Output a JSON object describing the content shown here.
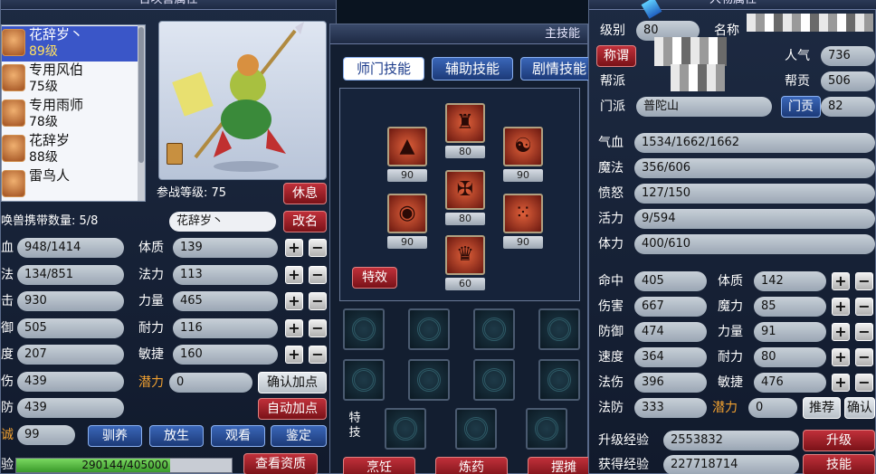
{
  "left": {
    "title": "召唤兽属性",
    "pets": [
      {
        "name": "花辞岁丶",
        "level": "89级",
        "selected": true
      },
      {
        "name": "专用风伯",
        "level": "75级"
      },
      {
        "name": "专用雨师",
        "level": "78级"
      },
      {
        "name": "花辞岁",
        "level": "88级"
      },
      {
        "name": "雷鸟人",
        "level": ""
      }
    ],
    "battle_level_label": "参战等级:",
    "battle_level": "75",
    "rest_btn": "休息",
    "carry_label": "唤兽携带数量:",
    "carry_value": "5/8",
    "pet_name_value": "花辞岁丶",
    "rename_btn": "改名",
    "stats_left": [
      {
        "label": "血",
        "value": "948/1414"
      },
      {
        "label": "法",
        "value": "134/851"
      },
      {
        "label": "击",
        "value": "930"
      },
      {
        "label": "御",
        "value": "505"
      },
      {
        "label": "度",
        "value": "207"
      },
      {
        "label": "伤",
        "value": "439"
      },
      {
        "label": "防",
        "value": "439"
      },
      {
        "label": "诚",
        "value": "99"
      }
    ],
    "stats_right": [
      {
        "label": "体质",
        "value": "139"
      },
      {
        "label": "法力",
        "value": "113"
      },
      {
        "label": "力量",
        "value": "465"
      },
      {
        "label": "耐力",
        "value": "116"
      },
      {
        "label": "敏捷",
        "value": "160"
      }
    ],
    "potential_label": "潜力",
    "potential_value": "0",
    "confirm_points_btn": "确认加点",
    "auto_points_btn": "自动加点",
    "tame_btn": "驯养",
    "release_btn": "放生",
    "watch_btn": "观看",
    "appraise_btn": "鉴定",
    "exp_label": "验",
    "exp_value": "290144/405000",
    "exp_fraction": 0.716,
    "view_quality_btn": "查看资质",
    "plus": "+",
    "minus": "−"
  },
  "middle": {
    "title": "主技能",
    "tabs": [
      "师门技能",
      "辅助技能",
      "剧情技能"
    ],
    "skills": [
      {
        "icon": "stupa-icon",
        "glyph": "▲",
        "level": "90"
      },
      {
        "icon": "helmet-icon",
        "glyph": "♜",
        "level": "80"
      },
      {
        "icon": "head-icon",
        "glyph": "☯",
        "level": "90"
      },
      {
        "icon": "seal-icon",
        "glyph": "◉",
        "level": "90"
      },
      {
        "icon": "rune-icon",
        "glyph": "✠",
        "level": "80"
      },
      {
        "icon": "dice-icon",
        "glyph": "⁙",
        "level": "90"
      },
      {
        "icon": "crown-icon",
        "glyph": "♛",
        "level": "60"
      }
    ],
    "effect_btn": "特效",
    "special_label": "特技",
    "bottom_btns": [
      "烹饪",
      "炼药",
      "摆摊"
    ]
  },
  "right": {
    "title": "人物属性",
    "level_label": "级别",
    "level_value": "80",
    "name_label": "名称",
    "title_btn": "称谓",
    "popularity_label": "人气",
    "popularity_value": "736",
    "guild_label": "帮派",
    "guild_contrib_label": "帮贡",
    "guild_contrib_value": "506",
    "school_label": "门派",
    "school_value": "普陀山",
    "school_contrib_btn": "门贡",
    "school_contrib_value": "82",
    "vitals": [
      {
        "label": "气血",
        "value": "1534/1662/1662"
      },
      {
        "label": "魔法",
        "value": "356/606"
      },
      {
        "label": "愤怒",
        "value": "127/150"
      },
      {
        "label": "活力",
        "value": "9/594"
      },
      {
        "label": "体力",
        "value": "400/610"
      }
    ],
    "stats_left": [
      {
        "label": "命中",
        "value": "405"
      },
      {
        "label": "伤害",
        "value": "667"
      },
      {
        "label": "防御",
        "value": "474"
      },
      {
        "label": "速度",
        "value": "364"
      },
      {
        "label": "法伤",
        "value": "396"
      },
      {
        "label": "法防",
        "value": "333"
      }
    ],
    "stats_right": [
      {
        "label": "体质",
        "value": "142"
      },
      {
        "label": "魔力",
        "value": "85"
      },
      {
        "label": "力量",
        "value": "91"
      },
      {
        "label": "耐力",
        "value": "80"
      },
      {
        "label": "敏捷",
        "value": "476"
      }
    ],
    "potential_label": "潜力",
    "potential_value": "0",
    "recommend_btn": "推荐",
    "confirm_btn": "确认",
    "upgrade_exp_label": "升级经验",
    "upgrade_exp_value": "2553832",
    "upgrade_btn": "升级",
    "gained_exp_label": "获得经验",
    "gained_exp_value": "227718714",
    "skills_btn": "技能"
  }
}
